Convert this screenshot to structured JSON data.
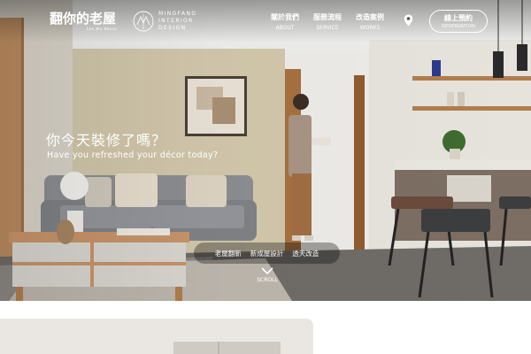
{
  "header": {
    "logo_cn": "翻你的老屋",
    "logo_en": "Leo Wu House",
    "brand_lines": [
      "MINGFANG",
      "INTERIOR",
      "DESIGN"
    ],
    "nav": [
      {
        "zh": "關於我們",
        "en": "ABOUT"
      },
      {
        "zh": "服務流程",
        "en": "SERVICE"
      },
      {
        "zh": "改造案例",
        "en": "WORKS"
      }
    ],
    "location_icon": "map-pin-icon",
    "cta": {
      "zh": "線上預約",
      "en": "RESERVATION"
    }
  },
  "hero": {
    "headline": "你今天裝修了嗎？",
    "subline": "Have you refreshed your décor today?",
    "tags": [
      "老屋翻新",
      "新成屋設計",
      "透天改造"
    ],
    "scroll_label": "SCROLL"
  },
  "colors": {
    "wall": "#e7e2d8",
    "accent_wall": "#cfc3a8",
    "floor": "#6e6a66",
    "wood": "#c9a27a",
    "sofa": "#8a8c90",
    "text_light": "#ffffff"
  }
}
